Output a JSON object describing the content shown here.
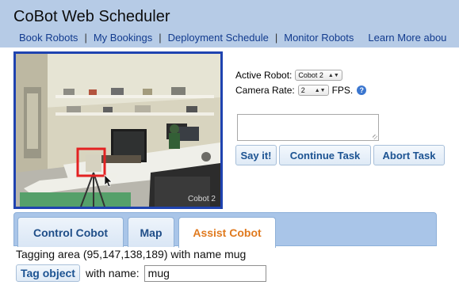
{
  "header": {
    "title": "CoBot Web Scheduler",
    "nav": [
      "Book Robots",
      "My Bookings",
      "Deployment Schedule",
      "Monitor Robots",
      "Learn More abou"
    ],
    "separator": "|",
    "background": "#b6cbe6"
  },
  "camera": {
    "overlay_text": "Cobot 2",
    "selection_color": "#e32222"
  },
  "controls": {
    "active_robot_label": "Active Robot:",
    "active_robot_value": "Cobot 2",
    "camera_rate_label": "Camera Rate:",
    "camera_rate_value": "2",
    "fps_label": "FPS.",
    "help_icon": "?",
    "speech_text": ""
  },
  "buttons": {
    "say": "Say it!",
    "continue": "Continue Task",
    "abort": "Abort Task"
  },
  "tabs": [
    {
      "label": "Control Cobot",
      "active": false
    },
    {
      "label": "Map",
      "active": false
    },
    {
      "label": "Assist Cobot",
      "active": true
    }
  ],
  "assist": {
    "status": "Tagging area (95,147,138,189) with name mug",
    "tag_button": "Tag object",
    "name_label": "with name:",
    "name_value": "mug"
  },
  "colors": {
    "accent_blue": "#1f43b0",
    "tab_active_text": "#e07a1f",
    "button_text": "#1c5392"
  }
}
